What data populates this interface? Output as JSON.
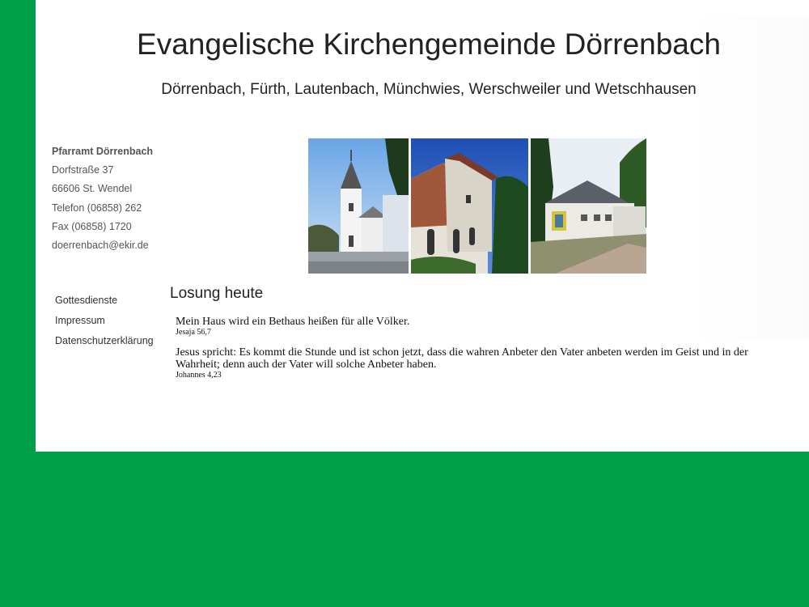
{
  "header": {
    "title": "Evangelische Kirchengemeinde Dörrenbach",
    "subtitle": "Dörrenbach, Fürth, Lautenbach, Münchwies, Werschweiler und Wetschhausen"
  },
  "contact": {
    "name": "Pfarramt Dörrenbach",
    "street": "Dorfstraße 37",
    "city": "66606 St. Wendel",
    "phone": "Telefon (06858) 262",
    "fax": "Fax (06858) 1720",
    "email": "doerrenbach@ekir.de"
  },
  "nav": {
    "items": [
      {
        "label": "Gottesdienste"
      },
      {
        "label": "Impressum"
      },
      {
        "label": "Datenschutzerklärung"
      }
    ]
  },
  "losung": {
    "heading": "Losung heute",
    "verses": [
      {
        "text": "Mein Haus wird ein Bethaus heißen für alle Völker.",
        "ref": "Jesaja 56,7"
      },
      {
        "text": "Jesus spricht: Es kommt die Stunde und ist schon jetzt, dass die wahren Anbeter den Vater anbeten werden im Geist und in der Wahrheit; denn auch der Vater will solche Anbeter haben.",
        "ref": "Johannes 4,23"
      }
    ]
  },
  "colors": {
    "background": "#00a04a",
    "content": "#ffffff"
  }
}
